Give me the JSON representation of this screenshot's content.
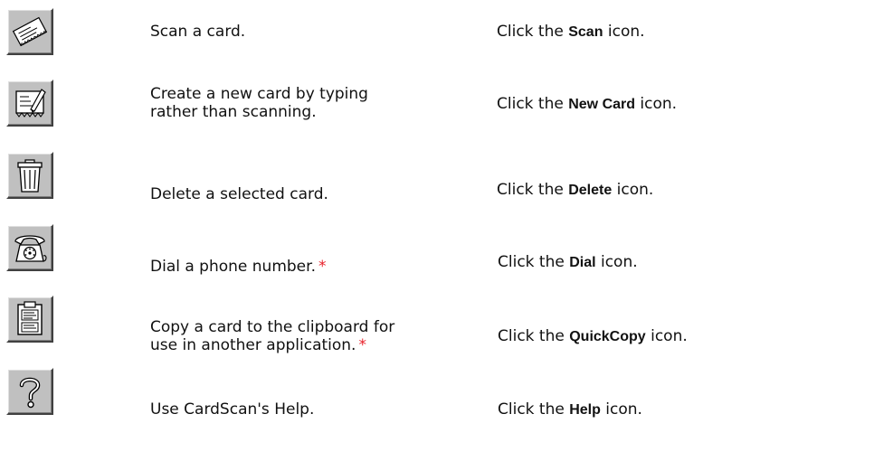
{
  "rows": [
    {
      "icon": "scan-card-icon",
      "task_lines": [
        "Scan a card."
      ],
      "task_star": "",
      "action_prefix": "Click the",
      "action_bold": "Scan",
      "action_suffix": "icon."
    },
    {
      "icon": "new-card-icon",
      "task_lines": [
        "Create a new card by typing",
        "rather than scanning."
      ],
      "task_star": "",
      "action_prefix": "Click the",
      "action_bold": "New Card",
      "action_suffix": "icon."
    },
    {
      "icon": "trash-icon",
      "task_lines": [
        "Delete a selected card."
      ],
      "task_star": "",
      "action_prefix": "Click the",
      "action_bold": "Delete",
      "action_suffix": "icon."
    },
    {
      "icon": "phone-icon",
      "task_lines": [
        "Dial a phone number."
      ],
      "task_star": "*",
      "action_prefix": "Click the",
      "action_bold": "Dial",
      "action_suffix": "icon."
    },
    {
      "icon": "quickcopy-icon",
      "task_lines": [
        "Copy a card to the clipboard for",
        "use in another application."
      ],
      "task_star": "*",
      "action_prefix": "Click the",
      "action_bold": "QuickCopy",
      "action_suffix": "icon."
    },
    {
      "icon": "help-icon",
      "task_lines": [
        "Use CardScan's Help."
      ],
      "task_star": "",
      "action_prefix": "Click the",
      "action_bold": "Help",
      "action_suffix": "icon."
    }
  ],
  "colors": {
    "button_face": "#c0c0c0",
    "asterisk": "#e8202a"
  }
}
